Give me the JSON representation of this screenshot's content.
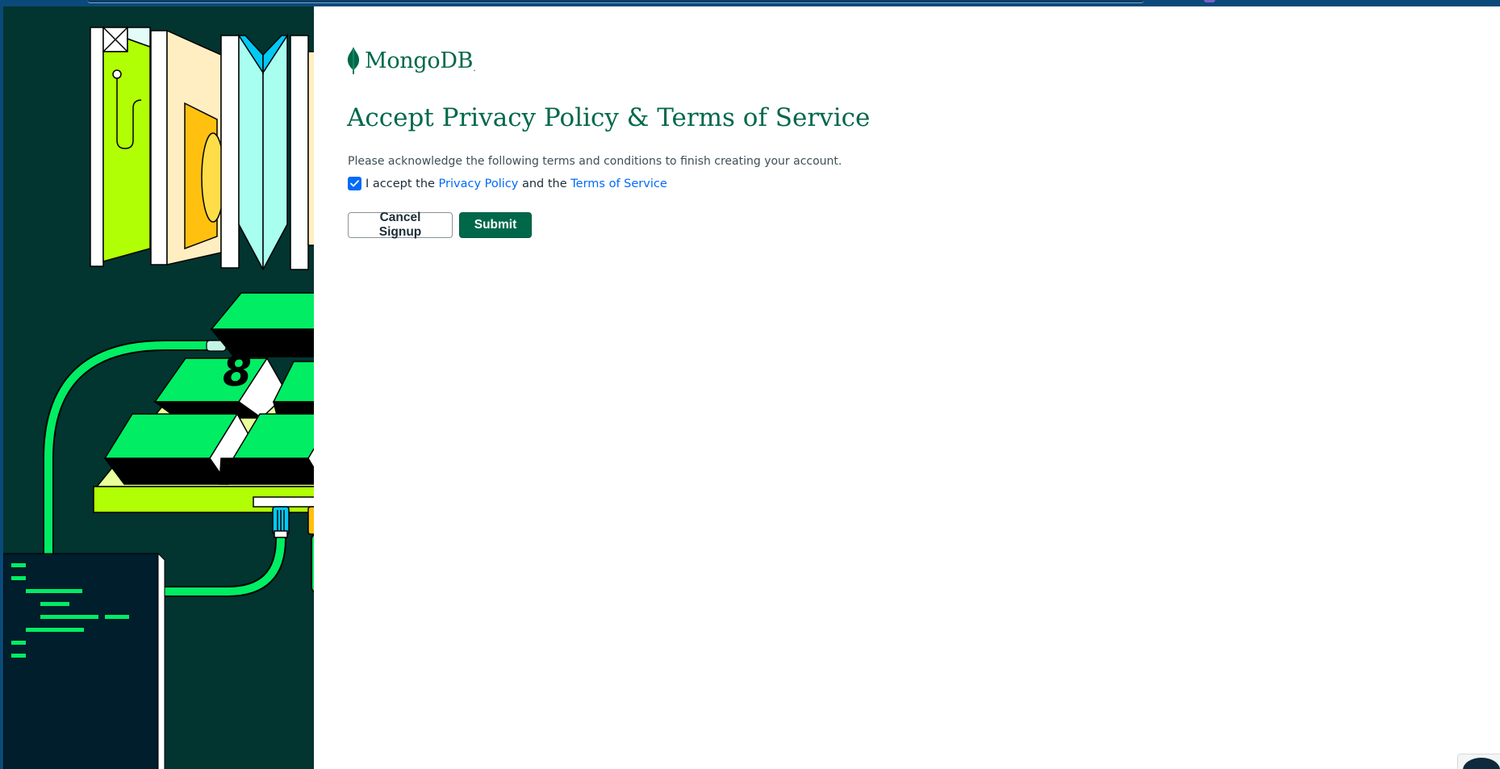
{
  "app": {
    "logo_text": "MongoDB",
    "logo_mark": "."
  },
  "page": {
    "title": "Accept Privacy Policy & Terms of Service",
    "description": "Please acknowledge the following terms and conditions to finish creating your account."
  },
  "consent": {
    "checked": true,
    "prefix": "I accept the",
    "privacy_link": "Privacy Policy",
    "middle": "and the",
    "terms_link": "Terms of Service"
  },
  "actions": {
    "cancel_label": "Cancel Signup",
    "submit_label": "Submit"
  },
  "illustration": {
    "key_number": "8"
  },
  "icons": {
    "logo": "mongodb-leaf-icon",
    "checkbox": "checkmark-icon"
  },
  "colors": {
    "brand_green": "#00684a",
    "panel_bg": "#023430",
    "link_blue": "#016bf8",
    "neon_green": "#00ed64",
    "lime": "#b1ff05"
  }
}
